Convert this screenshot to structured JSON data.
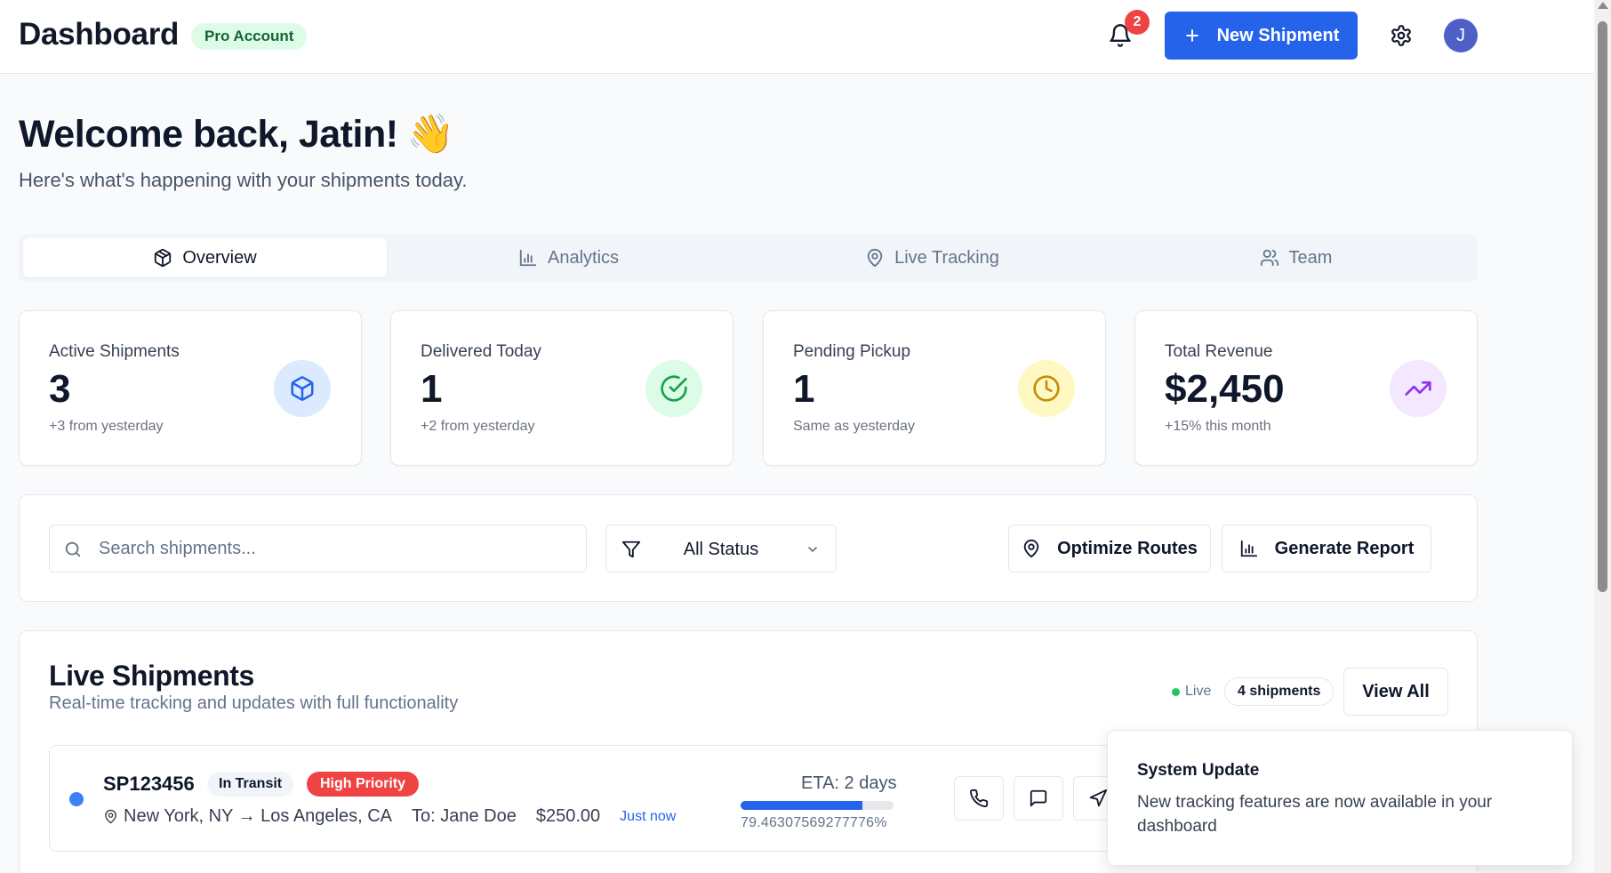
{
  "header": {
    "title": "Dashboard",
    "account_badge": "Pro Account",
    "notification_count": "2",
    "new_shipment_label": "New Shipment",
    "avatar_initial": "J"
  },
  "welcome": {
    "heading": "Welcome back, Jatin!",
    "emoji": "👋",
    "subtitle": "Here's what's happening with your shipments today."
  },
  "tabs": [
    {
      "label": "Overview",
      "icon": "package-icon",
      "active": true
    },
    {
      "label": "Analytics",
      "icon": "bar-chart-icon",
      "active": false
    },
    {
      "label": "Live Tracking",
      "icon": "map-pin-icon",
      "active": false
    },
    {
      "label": "Team",
      "icon": "users-icon",
      "active": false
    }
  ],
  "stats": [
    {
      "label": "Active Shipments",
      "value": "3",
      "sub": "+3 from yesterday",
      "icon": "package-icon",
      "color": "#2563eb",
      "bg": "#dbeafe"
    },
    {
      "label": "Delivered Today",
      "value": "1",
      "sub": "+2 from yesterday",
      "icon": "check-circle-icon",
      "color": "#16a34a",
      "bg": "#dcfce7"
    },
    {
      "label": "Pending Pickup",
      "value": "1",
      "sub": "Same as yesterday",
      "icon": "clock-icon",
      "color": "#ca8a04",
      "bg": "#fef9c3"
    },
    {
      "label": "Total Revenue",
      "value": "$2,450",
      "sub": "+15% this month",
      "icon": "trending-up-icon",
      "color": "#9333ea",
      "bg": "#f3e8ff"
    }
  ],
  "filters": {
    "search_placeholder": "Search shipments...",
    "status_selected": "All Status",
    "optimize_label": "Optimize Routes",
    "report_label": "Generate Report"
  },
  "live": {
    "title": "Live Shipments",
    "subtitle": "Real-time tracking and updates with full functionality",
    "live_label": "Live",
    "count_label": "4 shipments",
    "view_all_label": "View All"
  },
  "shipments": [
    {
      "id": "SP123456",
      "status": "In Transit",
      "priority": "High Priority",
      "route": "New York, NY → Los Angeles, CA",
      "recipient": "To: Jane Doe",
      "amount": "$250.00",
      "updated": "Just now",
      "eta": "ETA: 2 days",
      "progress": 79.46307569277776,
      "progress_text": "79.46307569277776%"
    }
  ],
  "toast": {
    "title": "System Update",
    "message": "New tracking features are now available in your dashboard"
  },
  "colors": {
    "accent": "#2563eb",
    "danger": "#ef4444",
    "success": "#22c55e"
  }
}
